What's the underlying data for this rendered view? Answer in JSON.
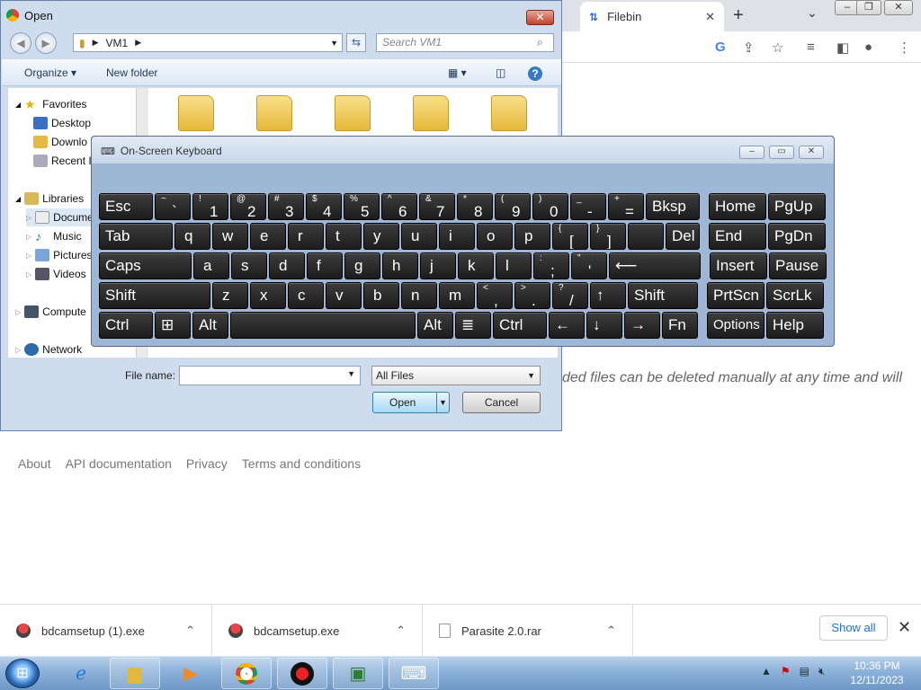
{
  "chrome": {
    "tab_title": "Filebin",
    "page_message": "ded files can be deleted manually at any time and will",
    "footer_links": [
      "About",
      "API documentation",
      "Privacy",
      "Terms and conditions"
    ]
  },
  "downloads": {
    "items": [
      "bdcamsetup (1).exe",
      "bdcamsetup.exe",
      "Parasite 2.0.rar"
    ],
    "show_all": "Show all"
  },
  "open_dialog": {
    "title": "Open",
    "address_path": "VM1",
    "search_placeholder": "Search VM1",
    "organize": "Organize",
    "new_folder": "New folder",
    "tree": [
      "Favorites",
      "Desktop",
      "Downlo",
      "Recent I",
      "Libraries",
      "Docume",
      "Music",
      "Pictures",
      "Videos",
      "Compute",
      "Network"
    ],
    "file_name_label": "File name:",
    "file_name_value": "",
    "filter": "All Files",
    "open_button": "Open",
    "cancel_button": "Cancel"
  },
  "osk": {
    "title": "On-Screen Keyboard",
    "rows": [
      [
        "Esc",
        "~|`",
        "!|1",
        "@|2",
        "#|3",
        "$|4",
        "%|5",
        "^|6",
        "&|7",
        "*|8",
        "(|9",
        ")|0",
        "_|-",
        "+|=",
        "Bksp",
        "Home",
        "PgUp"
      ],
      [
        "Tab",
        "q",
        "w",
        "e",
        "r",
        "t",
        "y",
        "u",
        "i",
        "o",
        "p",
        "{|[",
        "}|]",
        "||\\",
        "Del",
        "End",
        "PgDn"
      ],
      [
        "Caps",
        "a",
        "s",
        "d",
        "f",
        "g",
        "h",
        "j",
        "k",
        "l",
        ":|;",
        "\"|'",
        "⟵",
        "Insert",
        "Pause"
      ],
      [
        "Shift",
        "z",
        "x",
        "c",
        "v",
        "b",
        "n",
        "m",
        "<|,",
        ">|.",
        "?|/",
        "↑",
        "Shift",
        "PrtScn",
        "ScrLk"
      ],
      [
        "Ctrl",
        "⊞",
        "Alt",
        " ",
        "Alt",
        "≣",
        "Ctrl",
        "←",
        "↓",
        "→",
        "Fn",
        "Options",
        "Help"
      ]
    ]
  },
  "taskbar": {
    "time": "10:36 PM",
    "date": "12/11/2023"
  }
}
